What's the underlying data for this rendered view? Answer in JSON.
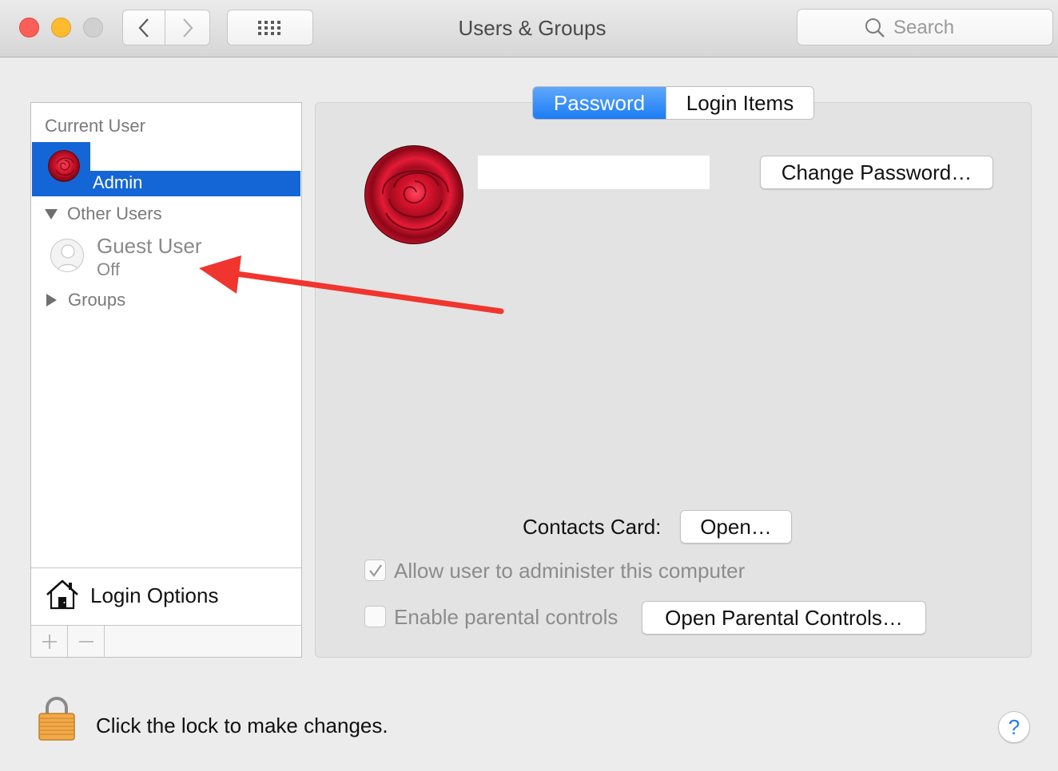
{
  "window": {
    "title": "Users & Groups",
    "search_placeholder": "Search"
  },
  "sidebar": {
    "current_user_header": "Current User",
    "current_user": {
      "role": "Admin"
    },
    "other_users_header": "Other Users",
    "guest_user": {
      "name": "Guest User",
      "status": "Off"
    },
    "groups_label": "Groups",
    "login_options_label": "Login Options"
  },
  "tabs": [
    {
      "label": "Password",
      "selected": true
    },
    {
      "label": "Login Items",
      "selected": false
    }
  ],
  "panel": {
    "change_password_label": "Change Password…",
    "contacts_card_label": "Contacts Card:",
    "open_label": "Open…",
    "allow_admin_label": "Allow user to administer this computer",
    "allow_admin_checked": true,
    "parental_controls_label": "Enable parental controls",
    "parental_controls_checked": false,
    "open_parental_label": "Open Parental Controls…"
  },
  "footer": {
    "lock_text": "Click the lock to make changes.",
    "help_label": "?"
  },
  "colors": {
    "accent": "#1b7cf5",
    "selection": "#1466d6",
    "annotation_arrow": "#f0352e"
  }
}
